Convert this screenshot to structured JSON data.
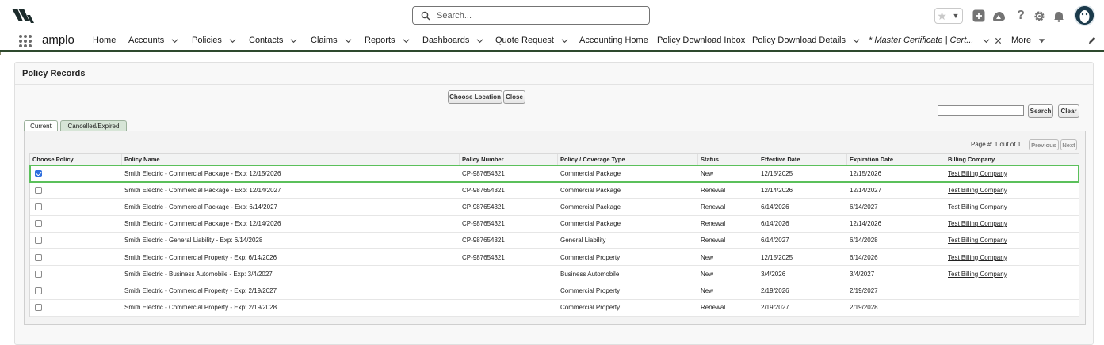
{
  "header": {
    "search_placeholder": "Search...",
    "icons": [
      "star-icon",
      "dropdown-icon",
      "add-icon",
      "trailhead-icon",
      "help-icon",
      "settings-icon",
      "bell-icon",
      "avatar"
    ]
  },
  "nav": {
    "app_name": "amplo",
    "items": [
      {
        "label": "Home",
        "has_menu": false
      },
      {
        "label": "Accounts",
        "has_menu": true
      },
      {
        "label": "Policies",
        "has_menu": true
      },
      {
        "label": "Contacts",
        "has_menu": true
      },
      {
        "label": "Claims",
        "has_menu": true
      },
      {
        "label": "Reports",
        "has_menu": true
      },
      {
        "label": "Dashboards",
        "has_menu": true
      },
      {
        "label": "Quote Request",
        "has_menu": true
      },
      {
        "label": "Accounting Home",
        "has_menu": false
      },
      {
        "label": "Policy Download Inbox",
        "has_menu": false
      },
      {
        "label": "Policy Download Details",
        "has_menu": true
      }
    ],
    "active_tab": "* Master Certificate | Cert...",
    "more_label": "More"
  },
  "panel": {
    "title": "Policy Records",
    "choose_location_label": "Choose Location",
    "close_label": "Close",
    "search_label": "Search",
    "clear_label": "Clear",
    "search_value": "",
    "tabs": [
      "Current",
      "Cancelled/Expired"
    ],
    "page_label": "Page #:  1 out of  1",
    "previous_label": "Previous",
    "next_label": "Next"
  },
  "table": {
    "columns": [
      "Choose Policy",
      "Policy Name",
      "Policy Number",
      "Policy / Coverage Type",
      "Status",
      "Effective Date",
      "Expiration Date",
      "Billing Company"
    ],
    "rows": [
      {
        "checked": true,
        "name": "Smith Electric - Commercial Package - Exp: 12/15/2026",
        "number": "CP-987654321",
        "type": "Commercial Package",
        "status": "New",
        "effective": "12/15/2025",
        "expiration": "12/15/2026",
        "billing": "Test Billing Company"
      },
      {
        "checked": false,
        "name": "Smith Electric - Commercial Package - Exp: 12/14/2027",
        "number": "CP-987654321",
        "type": "Commercial Package",
        "status": "Renewal",
        "effective": "12/14/2026",
        "expiration": "12/14/2027",
        "billing": "Test Billing Company"
      },
      {
        "checked": false,
        "name": "Smith Electric - Commercial Package - Exp: 6/14/2027",
        "number": "CP-987654321",
        "type": "Commercial Package",
        "status": "Renewal",
        "effective": "6/14/2026",
        "expiration": "6/14/2027",
        "billing": "Test Billing Company"
      },
      {
        "checked": false,
        "name": "Smith Electric - Commercial Package - Exp: 12/14/2026",
        "number": "CP-987654321",
        "type": "Commercial Package",
        "status": "Renewal",
        "effective": "6/14/2026",
        "expiration": "12/14/2026",
        "billing": "Test Billing Company"
      },
      {
        "checked": false,
        "name": "Smith Electric - General Liability - Exp: 6/14/2028",
        "number": "CP-987654321",
        "type": "General Liability",
        "status": "Renewal",
        "effective": "6/14/2027",
        "expiration": "6/14/2028",
        "billing": "Test Billing Company"
      },
      {
        "checked": false,
        "name": "Smith Electric - Commercial Property - Exp: 6/14/2026",
        "number": "CP-987654321",
        "type": "Commercial Property",
        "status": "New",
        "effective": "12/15/2025",
        "expiration": "6/14/2026",
        "billing": "Test Billing Company"
      },
      {
        "checked": false,
        "name": "Smith Electric - Business Automobile - Exp: 3/4/2027",
        "number": "",
        "type": "Business Automobile",
        "status": "New",
        "effective": "3/4/2026",
        "expiration": "3/4/2027",
        "billing": "Test Billing Company"
      },
      {
        "checked": false,
        "name": "Smith Electric - Commercial Property - Exp: 2/19/2027",
        "number": "",
        "type": "Commercial Property",
        "status": "New",
        "effective": "2/19/2026",
        "expiration": "2/19/2027",
        "billing": ""
      },
      {
        "checked": false,
        "name": "Smith Electric - Commercial Property - Exp: 2/19/2028",
        "number": "",
        "type": "Commercial Property",
        "status": "Renewal",
        "effective": "2/19/2027",
        "expiration": "2/19/2028",
        "billing": ""
      }
    ]
  },
  "colors": {
    "nav_underline": "#2e4a2e",
    "selected_row_outline": "#5bc05b",
    "checkbox_checked": "#2f6fde"
  }
}
